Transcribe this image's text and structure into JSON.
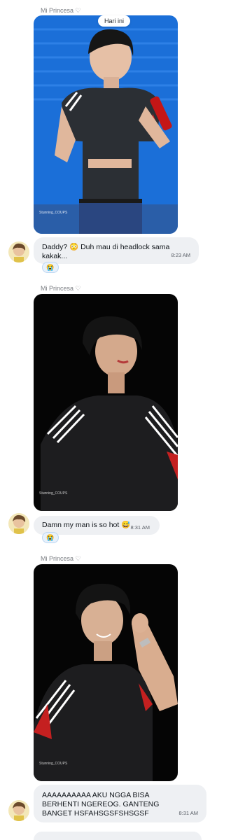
{
  "date_separator": "Hari ini",
  "colors": {
    "bubble": "#eef0f3",
    "reaction_bg": "#e8f1fb",
    "photo1_bg": "#1b6fd8",
    "photo_dark_bg": "#050505"
  },
  "messages": [
    {
      "sender": "Mi Princesa ♡",
      "image": {
        "alt": "concert photo",
        "watermark": "Stunning_COUPS"
      },
      "reply": {
        "text": "Daddy? 😳 Duh mau di headlock sama kakak...",
        "time": "8:23 AM",
        "reaction": "😭"
      }
    },
    {
      "sender": "Mi Princesa ♡",
      "image": {
        "alt": "concert photo",
        "watermark": "Stunning_COUPS"
      },
      "reply": {
        "text": "Damn my man is so hot 😅",
        "time": "8:31 AM",
        "reaction": "😭"
      }
    },
    {
      "sender": "Mi Princesa ♡",
      "image": {
        "alt": "concert photo",
        "watermark": "Stunning_COUPS"
      },
      "reply": {
        "text": "AAAAAAAAAA AKU NGGA BISA BERHENTI NGEREOG. GANTENG BANGET HSFAHSGSFSHSGSF",
        "time": "8:31 AM"
      }
    }
  ]
}
